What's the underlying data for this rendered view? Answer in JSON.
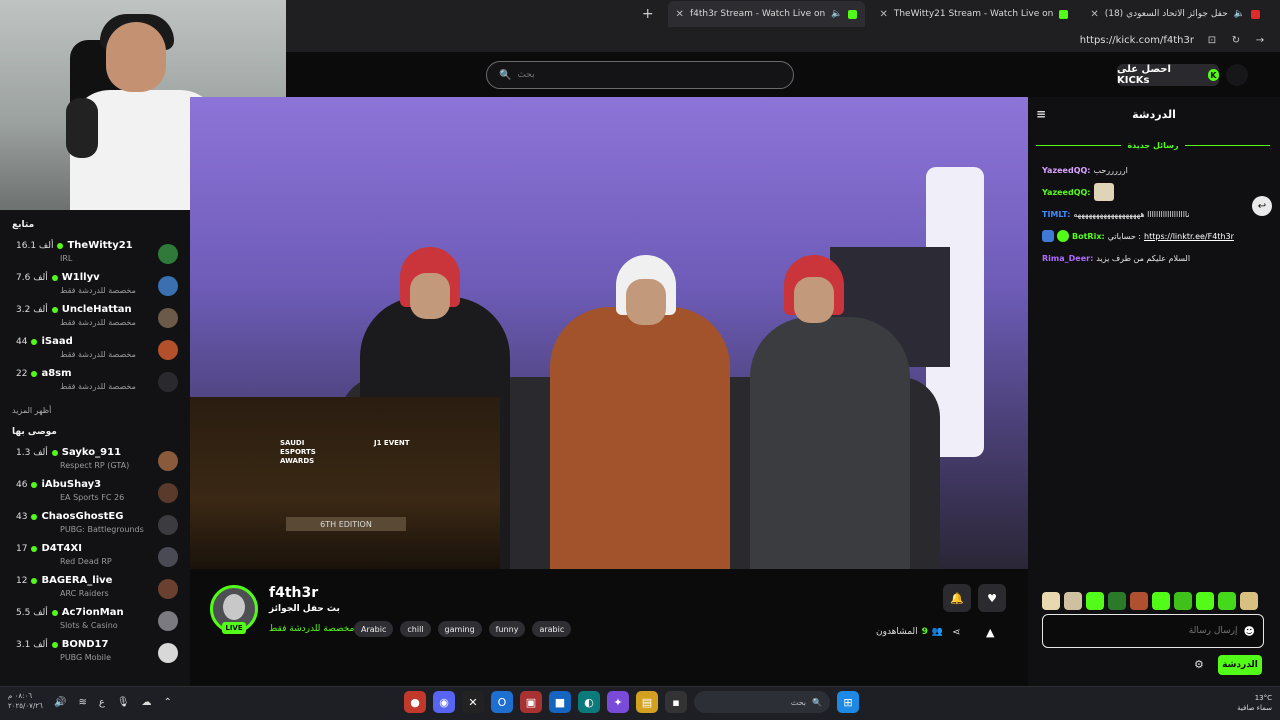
{
  "browser": {
    "tabs": [
      {
        "label": "(18) حفل جوائز الاتحاد السعودي",
        "active": false
      },
      {
        "label": "TheWitty21 Stream - Watch Live on",
        "active": false
      },
      {
        "label": "f4th3r Stream - Watch Live on",
        "active": true
      }
    ],
    "new_tab": "+",
    "url": "https://kick.com/f4th3r"
  },
  "header": {
    "search_placeholder": "بحث",
    "kicks_button": "احصل على KICKs"
  },
  "sidebar": {
    "following_title": "متابع",
    "following": [
      {
        "name": "TheWitty21",
        "count": "16.1 ألف",
        "category": "IRL",
        "avatar_color": "#2f7a3a"
      },
      {
        "name": "W1llyv",
        "count": "7.6 ألف",
        "category": "مخصصة للدردشة فقط",
        "avatar_color": "#3a6fb0"
      },
      {
        "name": "UncleHattan",
        "count": "3.2 ألف",
        "category": "مخصصة للدردشة فقط",
        "avatar_color": "#6b5a48"
      },
      {
        "name": "iSaad",
        "count": "44",
        "category": "مخصصة للدردشة فقط",
        "avatar_color": "#b2502b"
      },
      {
        "name": "a8sm",
        "count": "22",
        "category": "مخصصة للدردشة فقط",
        "avatar_color": "#2a2a2e"
      }
    ],
    "show_more": "أظهر المزيد",
    "recommended_title": "موصى بها",
    "recommended": [
      {
        "name": "Sayko_911",
        "count": "1.3 ألف",
        "category": "Respect RP (GTA)",
        "avatar_color": "#8a5a3c"
      },
      {
        "name": "iAbuShay3",
        "count": "46",
        "category": "EA Sports FC 26",
        "avatar_color": "#5a3a2a"
      },
      {
        "name": "ChaosGhostEG",
        "count": "43",
        "category": "PUBG: Battlegrounds",
        "avatar_color": "#3c3c40"
      },
      {
        "name": "D4T4XI",
        "count": "17",
        "category": "Red Dead RP",
        "avatar_color": "#4a4a55"
      },
      {
        "name": "BAGERA_live",
        "count": "12",
        "category": "ARC Raiders",
        "avatar_color": "#6a4030"
      },
      {
        "name": "Ac7ionMan",
        "count": "5.5 ألف",
        "category": "Slots & Casino",
        "avatar_color": "#7a7a80"
      },
      {
        "name": "BOND17",
        "count": "3.1 ألف",
        "category": "PUBG Mobile",
        "avatar_color": "#d8d8d8"
      }
    ]
  },
  "video": {
    "overlay_logo_left": "SAUDI ESPORTS AWARDS",
    "overlay_logo_right": "J1 EVENT",
    "overlay_edition": "6TH EDITION"
  },
  "stream": {
    "channel_name": "f4th3r",
    "title": "بث حفل الجوائز",
    "category": "مخصصة للدردشة فقط",
    "live_label": "LIVE",
    "tags": [
      "Arabic",
      "chill",
      "gaming",
      "funny",
      "arabic"
    ],
    "viewers_label": "المشاهدون",
    "viewers_count": "9"
  },
  "chat": {
    "title": "الدردشة",
    "new_messages": "رسائل جديدة",
    "messages": [
      {
        "user": "YazeedQQ:",
        "text": "ارررررحب",
        "user_color": "#d9a2ff"
      },
      {
        "user": "YazeedQQ:",
        "text": "",
        "user_color": "#53fc18"
      },
      {
        "user": "TIMLT:",
        "text": "ناااااااااااااااااا ههههههههههههههههههه",
        "user_color": "#3b8cff"
      },
      {
        "user": "BotRix:",
        "text": "حساباتي :",
        "link": "https://linktr.ee/F4th3r",
        "user_color": "#53fc18"
      },
      {
        "user": "Rima_Deer:",
        "text": "السلام عليكم من طرف يزيد",
        "user_color": "#b06bff"
      }
    ],
    "input_placeholder": "إرسال رسالة",
    "send_label": "الدردشة"
  },
  "taskbar": {
    "search_placeholder": "بحث",
    "time": "٠٨:٠٦ م",
    "date": "٢٠٢٥/٠٧/٢٦",
    "weather_temp": "13°C",
    "weather_text": "سماء صافية",
    "lang": "ع"
  },
  "colors": {
    "kick_green": "#53fc18",
    "background": "#0b0b0c",
    "panel": "#121214"
  }
}
